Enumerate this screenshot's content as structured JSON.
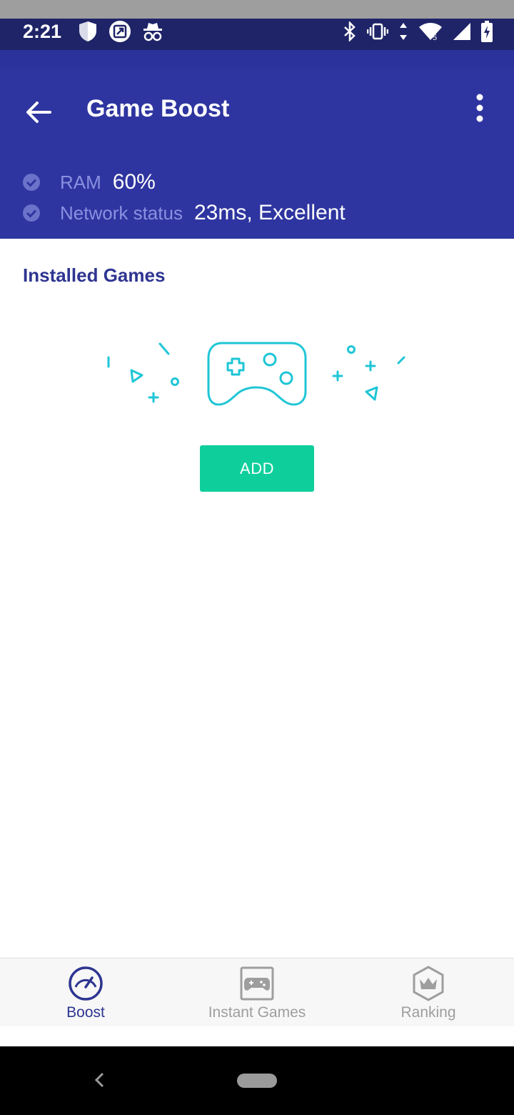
{
  "status_bar": {
    "time": "2:21",
    "left_icons": [
      "shield-icon",
      "screenshot-icon",
      "incognito-icon"
    ],
    "right_icons": [
      "bluetooth-icon",
      "vibrate-icon",
      "data-arrows-icon",
      "wifi-icon",
      "signal-icon",
      "battery-charging-icon"
    ]
  },
  "app_bar": {
    "title": "Game Boost",
    "back_icon": "arrow-back-icon",
    "menu_icon": "more-vert-icon",
    "metrics": [
      {
        "label": "RAM",
        "value": "60%"
      },
      {
        "label": "Network status",
        "value": "23ms, Excellent"
      }
    ]
  },
  "main": {
    "section_title": "Installed Games",
    "illustration_icon": "gamepad-icon",
    "add_button_label": "ADD"
  },
  "bottom_nav": {
    "items": [
      {
        "label": "Boost",
        "icon": "speedometer-icon",
        "active": true
      },
      {
        "label": "Instant Games",
        "icon": "gamepad-icon",
        "active": false
      },
      {
        "label": "Ranking",
        "icon": "crown-icon",
        "active": false
      }
    ]
  },
  "colors": {
    "status_bar": "#1f2468",
    "app_bar": "#2e35a0",
    "accent_teal": "#0ecf9c",
    "illustration": "#1ec6d6",
    "active_nav": "#2e3591",
    "inactive_nav": "#9e9e9e"
  }
}
